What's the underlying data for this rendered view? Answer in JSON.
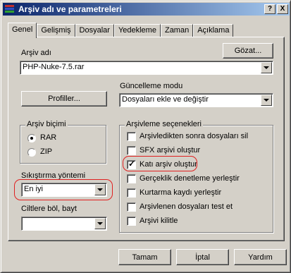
{
  "window": {
    "title": "Arşiv adı ve parametreleri",
    "help_label": "?",
    "close_label": "X"
  },
  "tabs": [
    {
      "label": "Genel",
      "active": true
    },
    {
      "label": "Gelişmiş"
    },
    {
      "label": "Dosyalar"
    },
    {
      "label": "Yedekleme"
    },
    {
      "label": "Zaman"
    },
    {
      "label": "Açıklama"
    }
  ],
  "archive_name": {
    "label": "Arşiv adı",
    "browse_label": "Gözat...",
    "value": "PHP-Nuke-7.5.rar"
  },
  "update_mode": {
    "label": "Güncelleme modu",
    "value": "Dosyaları ekle ve değiştir"
  },
  "profiles_label": "Profiller...",
  "archive_format": {
    "label": "Arşiv biçimi",
    "options": [
      {
        "label": "RAR",
        "selected": true
      },
      {
        "label": "ZIP",
        "selected": false
      }
    ]
  },
  "compression": {
    "label": "Sıkıştırma yöntemi",
    "value": "En iyi"
  },
  "split": {
    "label": "Ciltlere böl, bayt",
    "value": ""
  },
  "archiving_options": {
    "label": "Arşivleme seçenekleri",
    "items": [
      {
        "label": "Arşivledikten sonra dosyaları sil",
        "checked": false
      },
      {
        "label": "SFX arşivi oluştur",
        "checked": false
      },
      {
        "label": "Katı arşiv oluştur",
        "checked": true
      },
      {
        "label": "Gerçeklik denetleme yerleştir",
        "checked": false
      },
      {
        "label": "Kurtarma kaydı yerleştir",
        "checked": false
      },
      {
        "label": "Arşivlenen dosyaları test et",
        "checked": false
      },
      {
        "label": "Arşivi kilitle",
        "checked": false
      }
    ]
  },
  "footer": {
    "ok_label": "Tamam",
    "cancel_label": "İptal",
    "help_label": "Yardım"
  },
  "colors": {
    "title_start": "#0a246a",
    "title_end": "#a6caf0",
    "face": "#d4d0c8",
    "highlight_ring": "#e02020"
  }
}
